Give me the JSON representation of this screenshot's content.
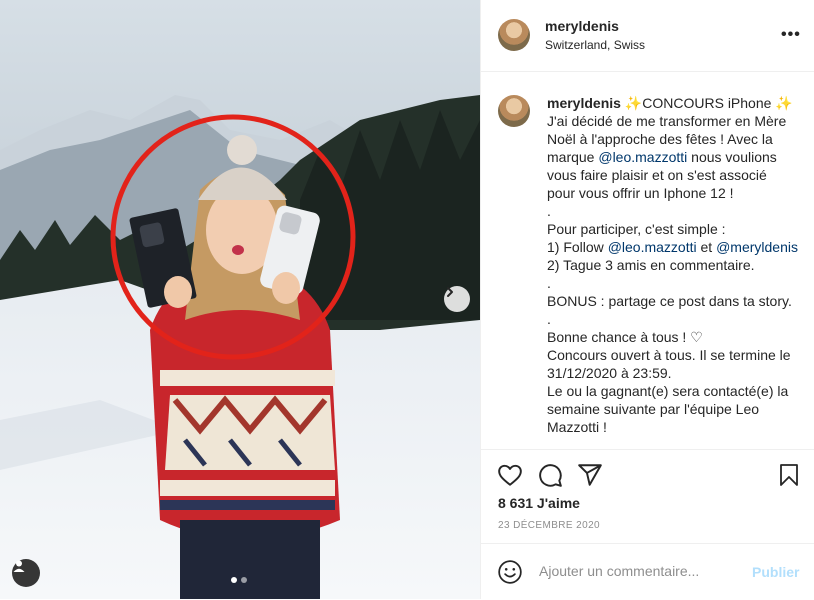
{
  "post": {
    "username": "meryldenis",
    "location": "Switzerland, Swiss",
    "more_icon": "more-horizontal-icon",
    "caption_lines": [
      {
        "parts": [
          {
            "text": "meryldenis",
            "type": "user"
          },
          {
            "text": " ✨CONCOURS iPhone ✨",
            "type": "text"
          }
        ]
      },
      {
        "parts": [
          {
            "text": "J'ai décidé de me transformer en Mère",
            "type": "text"
          }
        ]
      },
      {
        "parts": [
          {
            "text": "Noël à l'approche des fêtes ! Avec la",
            "type": "text"
          }
        ]
      },
      {
        "parts": [
          {
            "text": "marque ",
            "type": "text"
          },
          {
            "text": "@leo.mazzotti",
            "type": "mention"
          },
          {
            "text": " nous voulions",
            "type": "text"
          }
        ]
      },
      {
        "parts": [
          {
            "text": "vous faire plaisir et on s'est associé",
            "type": "text"
          }
        ]
      },
      {
        "parts": [
          {
            "text": "pour vous offrir un Iphone 12 !",
            "type": "text"
          }
        ]
      },
      {
        "parts": [
          {
            "text": ".",
            "type": "text"
          }
        ]
      },
      {
        "parts": [
          {
            "text": "Pour participer, c'est simple :",
            "type": "text"
          }
        ]
      },
      {
        "parts": [
          {
            "text": "1) Follow ",
            "type": "text"
          },
          {
            "text": "@leo.mazzotti",
            "type": "mention"
          },
          {
            "text": " et ",
            "type": "text"
          },
          {
            "text": "@meryldenis",
            "type": "mention"
          }
        ]
      },
      {
        "parts": [
          {
            "text": "2) Tague 3 amis en commentaire.",
            "type": "text"
          }
        ]
      },
      {
        "parts": [
          {
            "text": ".",
            "type": "text"
          }
        ]
      },
      {
        "parts": [
          {
            "text": "BONUS : partage ce post dans ta story.",
            "type": "text"
          }
        ]
      },
      {
        "parts": [
          {
            "text": ".",
            "type": "text"
          }
        ]
      },
      {
        "parts": [
          {
            "text": "Bonne chance à tous ! ♡",
            "type": "text"
          }
        ]
      },
      {
        "parts": [
          {
            "text": "Concours ouvert à tous. Il se termine le",
            "type": "text"
          }
        ]
      },
      {
        "parts": [
          {
            "text": "31/12/2020 à 23:59.",
            "type": "text"
          }
        ]
      },
      {
        "parts": [
          {
            "text": "Le ou la gagnant(e) sera contacté(e) la",
            "type": "text"
          }
        ]
      },
      {
        "parts": [
          {
            "text": "semaine suivante par l'équipe Leo",
            "type": "text"
          }
        ]
      },
      {
        "parts": [
          {
            "text": "Mazzotti !",
            "type": "text"
          }
        ]
      }
    ],
    "likes_text": "8 631 J'aime",
    "date_text": "23 DÉCEMBRE 2020",
    "comment_placeholder": "Ajouter un commentaire...",
    "publish_label": "Publier",
    "action_icons": [
      "heart-icon",
      "comment-icon",
      "share-icon",
      "bookmark-icon"
    ],
    "carousel": {
      "slides": 2,
      "current": 1
    },
    "colors": {
      "mention": "#00376b",
      "publish_disabled": "#b2dffc",
      "highlight_circle": "#e2231a",
      "muted": "#8e8e8e"
    }
  }
}
